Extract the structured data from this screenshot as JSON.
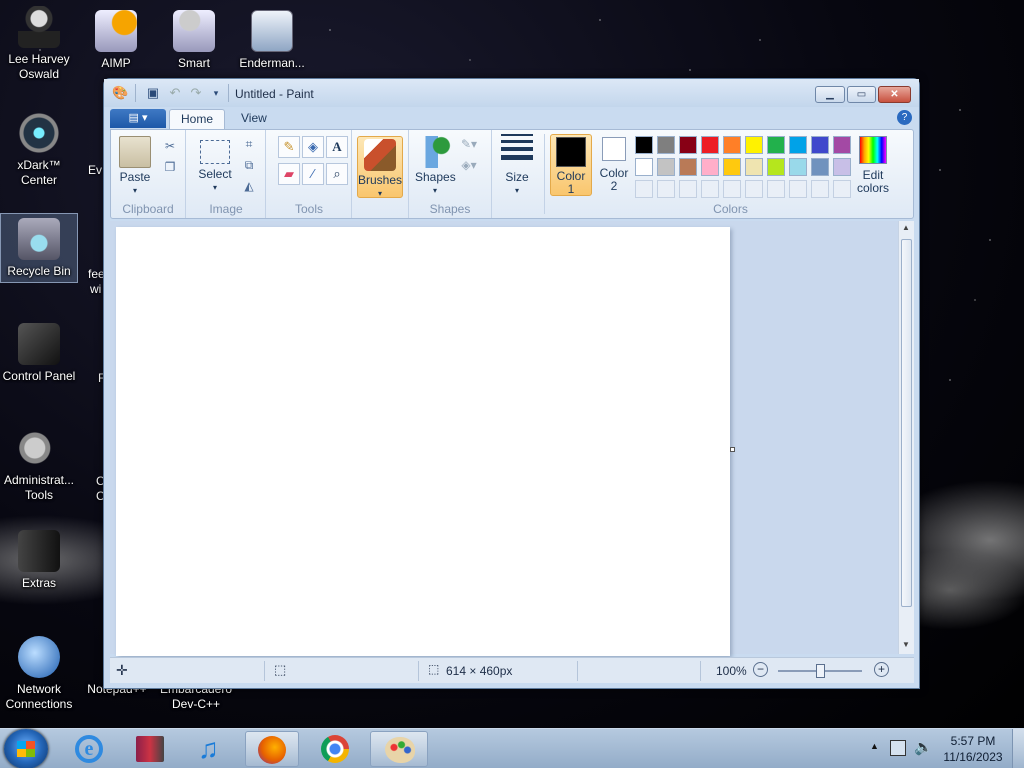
{
  "desktop": {
    "icons": [
      {
        "label": "Lee Harvey\nOswald"
      },
      {
        "label": "AIMP"
      },
      {
        "label": "Smart"
      },
      {
        "label": "Enderman..."
      },
      {
        "label": "xDark™\nCenter"
      },
      {
        "label": "Recycle Bin"
      },
      {
        "label": "Control Panel"
      },
      {
        "label": "Administrat...\nTools"
      },
      {
        "label": "Extras"
      },
      {
        "label": "Network\nConnections"
      },
      {
        "label": "Notepad++"
      },
      {
        "label": "Embarcadero\nDev-C++"
      }
    ],
    "partial_labels": [
      "Ev",
      "fee",
      "wi",
      "F",
      "C",
      "C"
    ]
  },
  "window": {
    "title": "Untitled - Paint",
    "tabs": [
      {
        "label": "Home",
        "active": true
      },
      {
        "label": "View",
        "active": false
      }
    ],
    "ribbon": {
      "clipboard": {
        "paste": "Paste",
        "group": "Clipboard"
      },
      "image": {
        "select": "Select",
        "group": "Image"
      },
      "tools": {
        "group": "Tools"
      },
      "brushes": {
        "label": "Brushes"
      },
      "shapes": {
        "label": "Shapes",
        "group": "Shapes"
      },
      "size": {
        "label": "Size"
      },
      "color1": {
        "label": "Color\n1",
        "color": "#000000"
      },
      "color2": {
        "label": "Color\n2",
        "color": "#ffffff"
      },
      "colors_group": "Colors",
      "edit_colors": "Edit\ncolors",
      "palette": [
        "#000000",
        "#7f7f7f",
        "#880015",
        "#ed1c24",
        "#ff7f27",
        "#fff200",
        "#22b14c",
        "#00a2e8",
        "#3f48cc",
        "#a349a4",
        "#ffffff",
        "#c3c3c3",
        "#b97a57",
        "#ffaec9",
        "#ffc90e",
        "#efe4b0",
        "#b5e61d",
        "#99d9ea",
        "#7092be",
        "#c8bfe7"
      ]
    },
    "status": {
      "dimensions": "614 × 460px",
      "zoom": "100%"
    }
  },
  "taskbar": {
    "items": [
      {
        "name": "internet-explorer"
      },
      {
        "name": "winrar"
      },
      {
        "name": "itunes"
      },
      {
        "name": "firefox"
      },
      {
        "name": "chrome"
      },
      {
        "name": "paint",
        "active": true
      }
    ],
    "time": "5:57 PM",
    "date": "11/16/2023"
  }
}
